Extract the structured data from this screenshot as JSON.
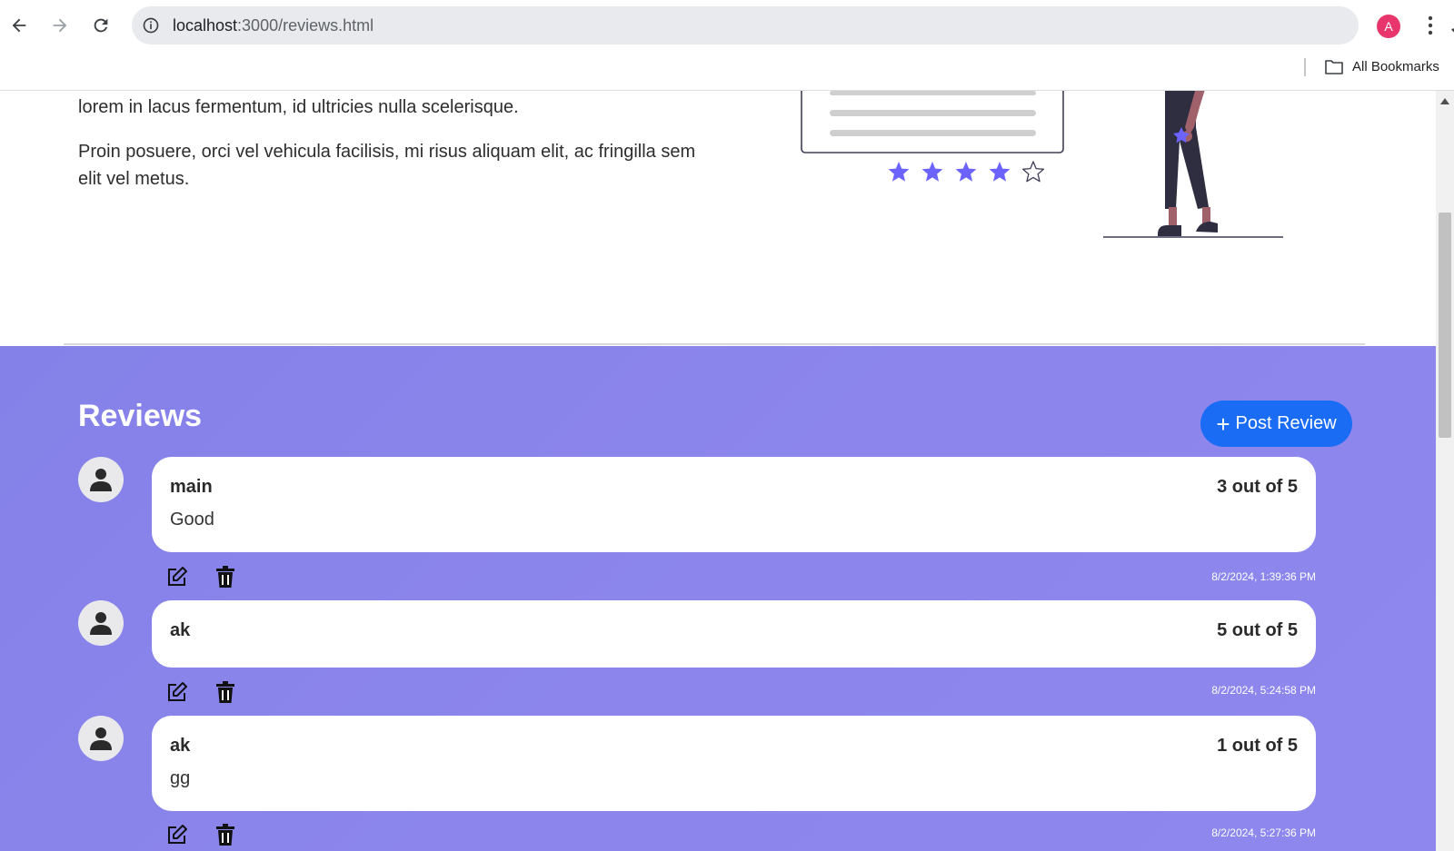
{
  "browser": {
    "url_host": "localhost",
    "url_path": ":3000/reviews.html",
    "profile_initial": "A",
    "bookmarks_label": "All Bookmarks"
  },
  "page": {
    "paragraph_1": "lorem in lacus fermentum, id ultricies nulla scelerisque.",
    "paragraph_2": "Proin posuere, orci vel vehicula facilisis, mi risus aliquam elit, ac fringilla sem elit vel metus.",
    "illustration_rating": 4,
    "illustration_rating_max": 5
  },
  "reviews": {
    "title": "Reviews",
    "post_button_label": "Post Review",
    "items": [
      {
        "user": "main",
        "rating": "3 out of 5",
        "text": "Good",
        "date": "8/2/2024, 1:39:36 PM"
      },
      {
        "user": "ak",
        "rating": "5 out of 5",
        "text": "",
        "date": "8/2/2024, 5:24:58 PM"
      },
      {
        "user": "ak",
        "rating": "1 out of 5",
        "text": "gg",
        "date": "8/2/2024, 5:27:36 PM"
      }
    ]
  },
  "colors": {
    "accent": "#1a6cf5",
    "section_bg": "#8a85ea",
    "star": "#6c63ff",
    "profile": "#e8366c"
  }
}
